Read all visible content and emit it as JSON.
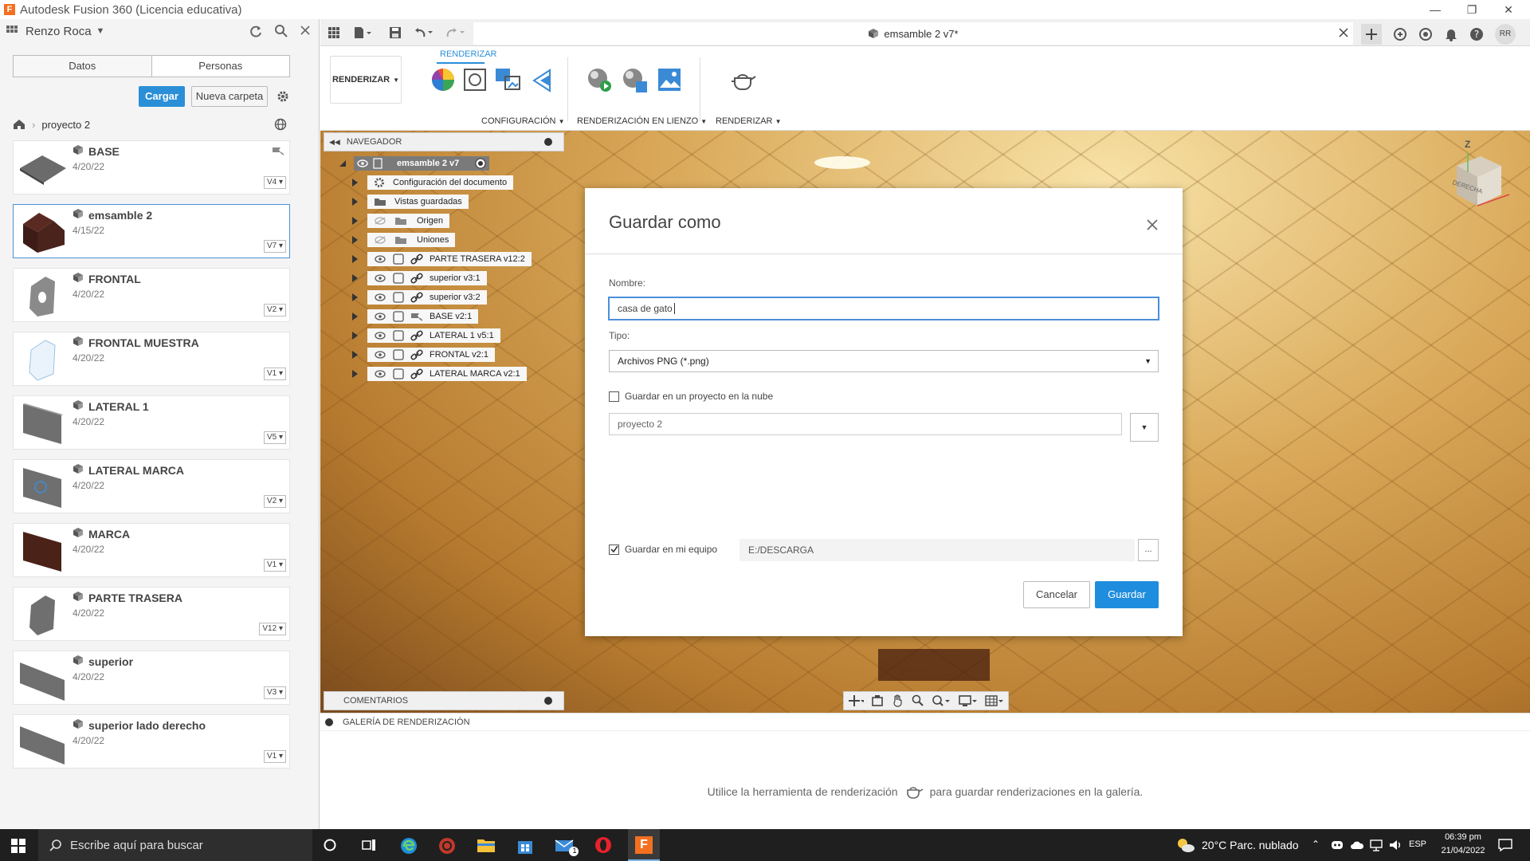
{
  "window": {
    "title": "Autodesk Fusion 360 (Licencia educativa)"
  },
  "data_panel": {
    "user": "Renzo Roca",
    "tabs": [
      "Datos",
      "Personas"
    ],
    "upload_label": "Cargar",
    "new_folder_label": "Nueva carpeta",
    "breadcrumb": "proyecto 2",
    "files": [
      {
        "name": "BASE",
        "date": "4/20/22",
        "version": "V4"
      },
      {
        "name": "emsamble 2",
        "date": "4/15/22",
        "version": "V7"
      },
      {
        "name": "FRONTAL",
        "date": "4/20/22",
        "version": "V2"
      },
      {
        "name": "FRONTAL MUESTRA",
        "date": "4/20/22",
        "version": "V1"
      },
      {
        "name": "LATERAL 1",
        "date": "4/20/22",
        "version": "V5"
      },
      {
        "name": "LATERAL MARCA",
        "date": "4/20/22",
        "version": "V2"
      },
      {
        "name": "MARCA",
        "date": "4/20/22",
        "version": "V1"
      },
      {
        "name": "PARTE TRASERA",
        "date": "4/20/22",
        "version": "V12"
      },
      {
        "name": "superior",
        "date": "4/20/22",
        "version": "V3"
      },
      {
        "name": "superior lado derecho",
        "date": "4/20/22",
        "version": "V1"
      }
    ]
  },
  "document_tab": {
    "title": "emsamble 2 v7*"
  },
  "avatar_initials": "RR",
  "ribbon": {
    "tab": "RENDERIZAR",
    "workspace": "RENDERIZAR",
    "groups": [
      "CONFIGURACIÓN",
      "RENDERIZACIÓN EN LIENZO",
      "RENDERIZAR"
    ]
  },
  "navigator": {
    "title": "NAVEGADOR",
    "root": "emsamble 2 v7",
    "items": [
      "Configuración del documento",
      "Vistas guardadas",
      "Origen",
      "Uniones",
      "PARTE TRASERA v12:2",
      "superior v3:1",
      "superior v3:2",
      "BASE v2:1",
      "LATERAL 1 v5:1",
      "FRONTAL v2:1",
      "LATERAL MARCA v2:1"
    ]
  },
  "viewcube": {
    "face": "DERECHA",
    "axis_label": "Z"
  },
  "comments": {
    "title": "COMENTARIOS"
  },
  "gallery": {
    "title": "GALERÍA DE RENDERIZACIÓN",
    "message_before": "Utilice la herramienta de renderización",
    "message_after": "para guardar renderizaciones en la galería."
  },
  "dialog": {
    "title": "Guardar como",
    "name_label": "Nombre:",
    "name_value": "casa de gato",
    "type_label": "Tipo:",
    "type_value": "Archivos PNG (*.png)",
    "cloud_label": "Guardar en un proyecto en la nube",
    "cloud_checked": false,
    "project_value": "proyecto 2",
    "local_label": "Guardar en mi equipo",
    "local_checked": true,
    "path_value": "E:/DESCARGA",
    "browse_label": "...",
    "cancel_label": "Cancelar",
    "save_label": "Guardar"
  },
  "taskbar": {
    "search_placeholder": "Escribe aquí para buscar",
    "weather": "20°C  Parc. nublado",
    "language": "ESP",
    "time": "06:39 pm",
    "date": "21/04/2022",
    "mail_badge": "1"
  },
  "colors": {
    "accent": "#2b8fd8",
    "selected_border": "#4a90d9",
    "taskbar": "#1f1f1f"
  }
}
